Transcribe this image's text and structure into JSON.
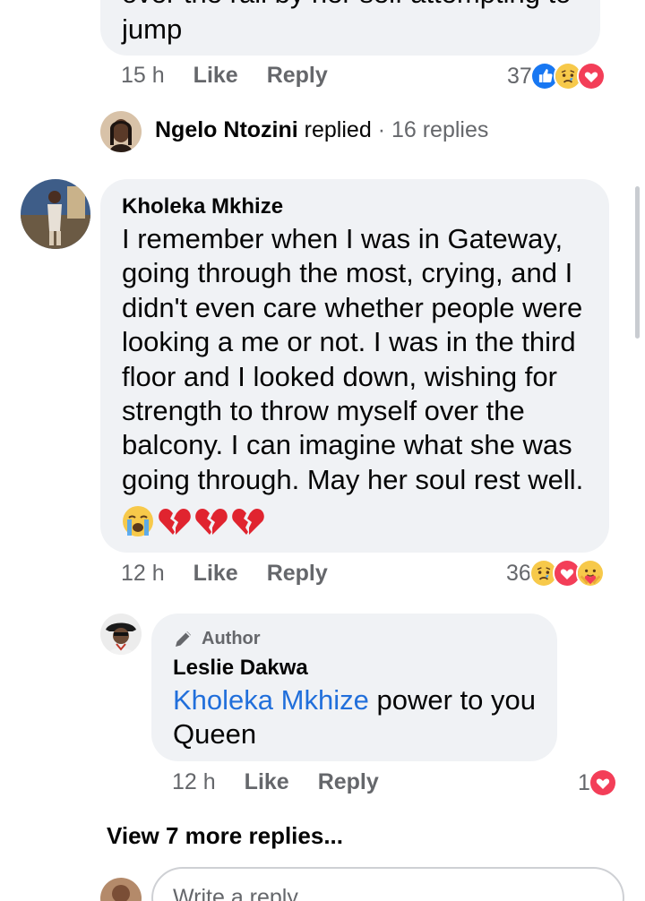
{
  "top_comment": {
    "text_partial": "over the rail by her self attempting to",
    "text_last": "jump",
    "time": "15 h",
    "like_label": "Like",
    "reply_label": "Reply",
    "reaction_count": "37",
    "reactions": [
      "like-icon",
      "sad-icon",
      "love-icon"
    ]
  },
  "replied_summary": {
    "name": "Ngelo Ntozini",
    "verb": "replied",
    "separator": "·",
    "count": "16 replies"
  },
  "comment": {
    "author": "Kholeka Mkhize",
    "text": "I remember when I was in Gateway, going through the most, crying, and I didn't even care whether people were looking a me or not. I was in the third floor and I looked down, wishing for strength to throw myself over the balcony. I can imagine what she was going through. May her soul rest well.",
    "emojis": [
      "crying-face-icon",
      "broken-heart-icon",
      "broken-heart-icon",
      "broken-heart-icon"
    ],
    "time": "12 h",
    "like_label": "Like",
    "reply_label": "Reply",
    "reaction_count": "36",
    "reactions": [
      "sad-icon",
      "love-icon",
      "care-icon"
    ]
  },
  "reply": {
    "badge": "Author",
    "author": "Leslie Dakwa",
    "mention": "Kholeka Mkhize",
    "text_line1": " power to you",
    "text_line2": "Queen",
    "time": "12 h",
    "like_label": "Like",
    "reply_label": "Reply",
    "reaction_count": "1",
    "reactions": [
      "love-icon"
    ]
  },
  "view_more": "View 7 more replies...",
  "composer": {
    "placeholder": "Write a reply..."
  },
  "colors": {
    "bubble": "#f0f2f5",
    "meta_text": "#65676b",
    "link": "#216fdb",
    "like_blue": "#1877f2",
    "love_red": "#f33e58"
  }
}
